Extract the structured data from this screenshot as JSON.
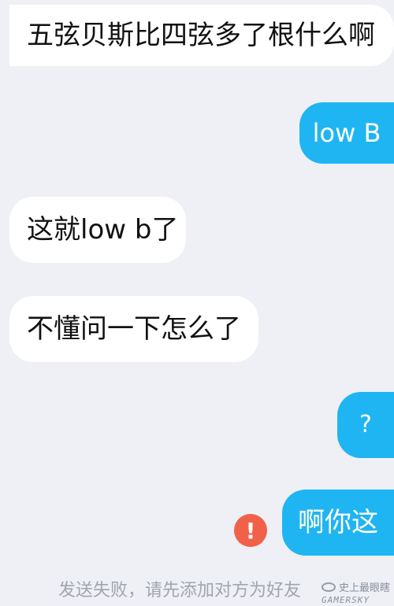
{
  "messages": [
    {
      "side": "in",
      "text": "五弦贝斯比四弦多了根什么啊"
    },
    {
      "side": "out",
      "text": "low B"
    },
    {
      "side": "in",
      "text": "这就low b了"
    },
    {
      "side": "in",
      "text": "不懂问一下怎么了"
    },
    {
      "side": "out",
      "text": "?"
    },
    {
      "side": "out",
      "text": "啊你这",
      "status": "failed"
    }
  ],
  "fail_icon": "!",
  "system_note": "发送失败，请先添加对方为好友",
  "watermark": {
    "line1": "史上最眼瞎",
    "line2": "GAMERSKY"
  },
  "colors": {
    "background": "#eef0f6",
    "incoming_bubble": "#ffffff",
    "outgoing_bubble": "#1fb5f2",
    "error": "#f1614a"
  }
}
